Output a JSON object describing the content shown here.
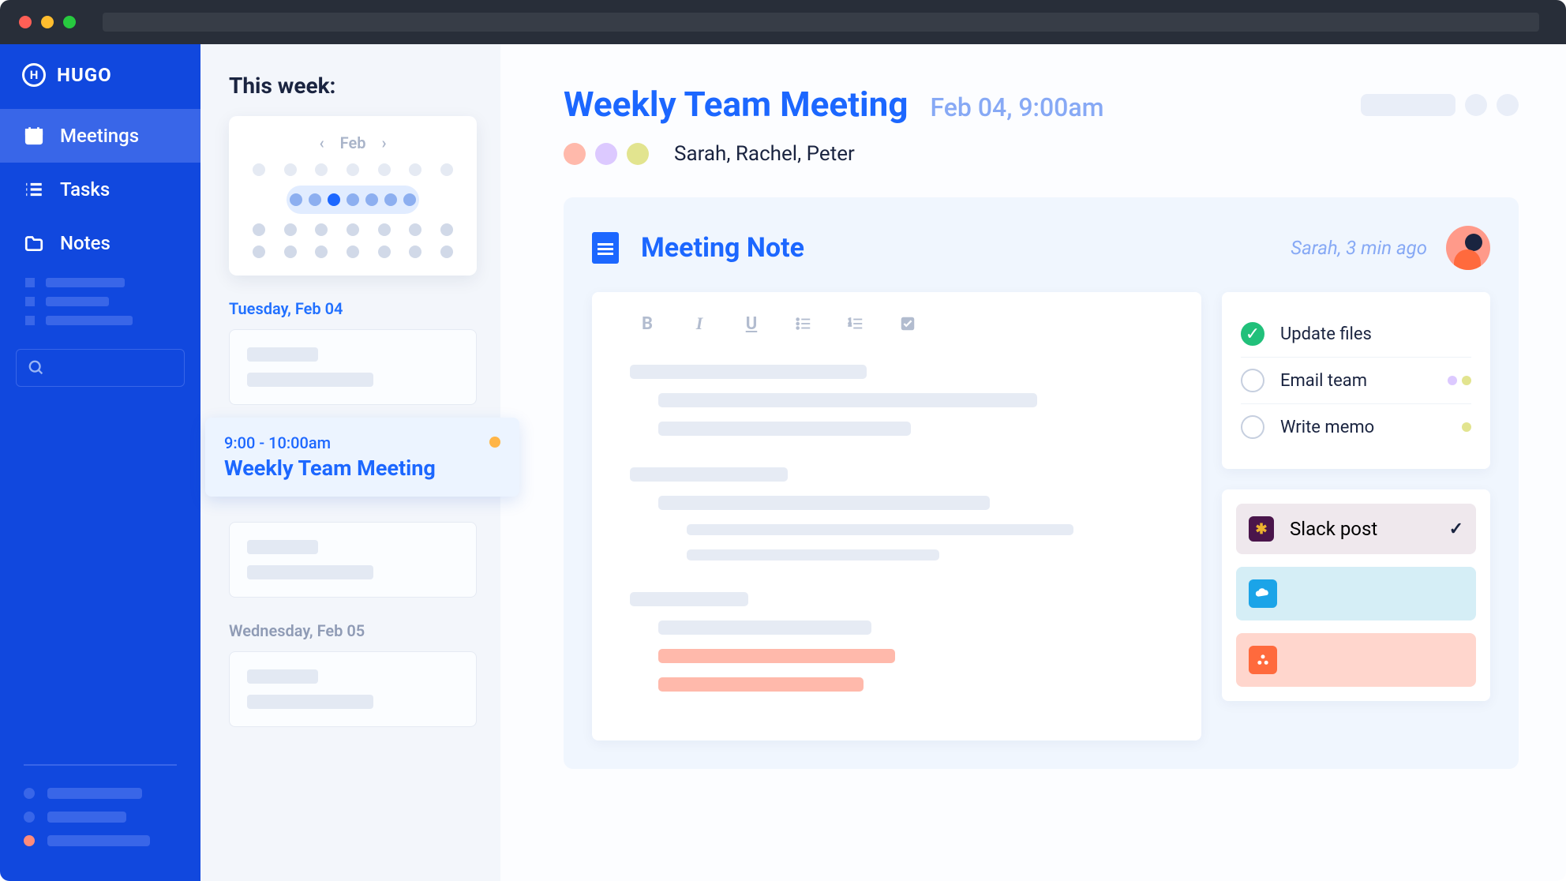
{
  "brand": "HUGO",
  "sidebar": {
    "items": [
      {
        "label": "Meetings"
      },
      {
        "label": "Tasks"
      },
      {
        "label": "Notes"
      }
    ],
    "bottom_dots": [
      "#3966e8",
      "#3966e8",
      "#ff8b7b"
    ]
  },
  "panel": {
    "heading": "This week:",
    "cal_month": "Feb",
    "day1": "Tuesday, Feb 04",
    "day2": "Wednesday, Feb 05",
    "selected_event": {
      "time": "9:00 - 10:00am",
      "title": "Weekly Team Meeting"
    }
  },
  "meeting": {
    "title": "Weekly Team Meeting",
    "date": "Feb 04, 9:00am",
    "attendees": "Sarah, Rachel, Peter",
    "attendee_colors": [
      "#ffb9ab",
      "#dcc9ff",
      "#e2e48f"
    ],
    "note_title": "Meeting Note",
    "note_meta": "Sarah, 3 min ago",
    "tasks": [
      {
        "label": "Update files",
        "done": true,
        "dots": []
      },
      {
        "label": "Email team",
        "done": false,
        "dots": [
          "#dcc9ff",
          "#e2e48f"
        ]
      },
      {
        "label": "Write memo",
        "done": false,
        "dots": [
          "#e2e48f"
        ]
      }
    ],
    "integrations": {
      "slack_label": "Slack post"
    }
  }
}
